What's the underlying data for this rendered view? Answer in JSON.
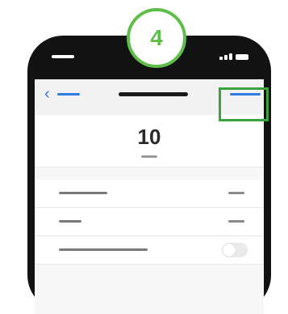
{
  "step": {
    "number": "4"
  },
  "screen": {
    "value": "10",
    "toggle": {
      "on": false
    }
  },
  "colors": {
    "accent_blue": "#2f7be4",
    "step_green": "#5fbe4a",
    "highlight_green": "#3ba33b"
  },
  "icons": {
    "back": "chevron-left-icon"
  }
}
